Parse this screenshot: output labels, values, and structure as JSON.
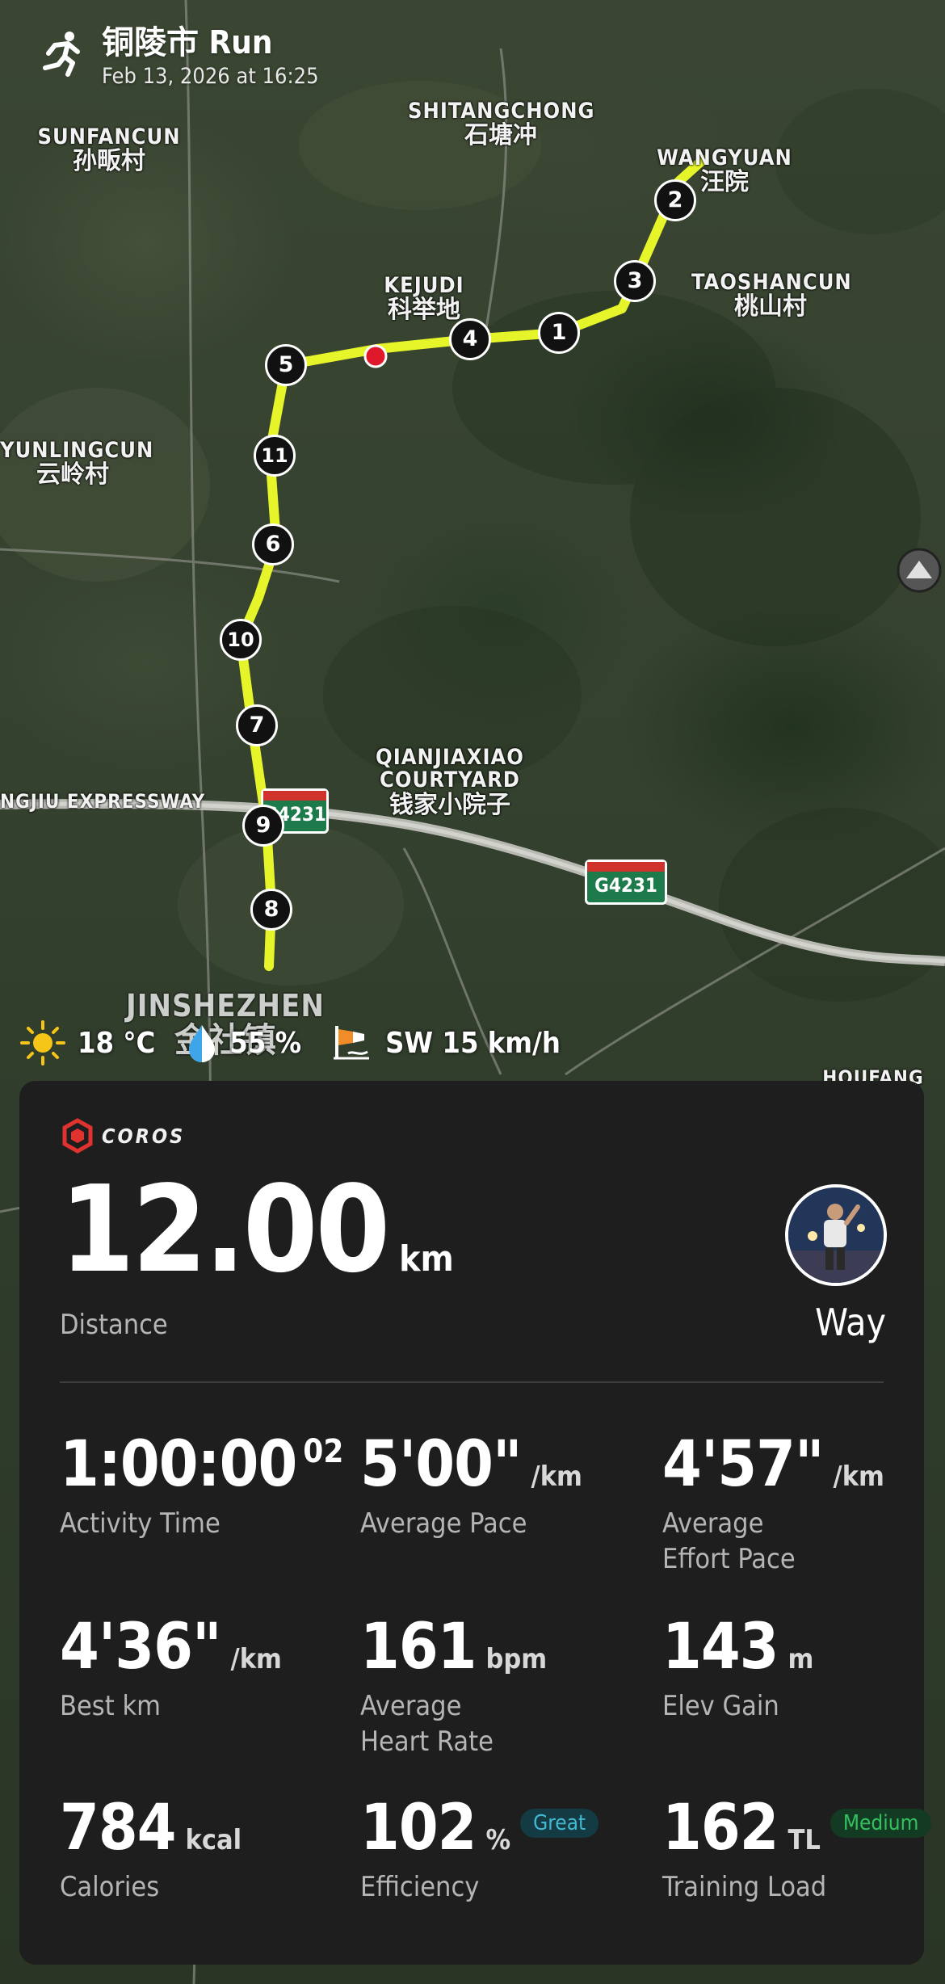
{
  "header": {
    "title": "铜陵市 Run",
    "datetime": "Feb 13, 2026 at 16:25"
  },
  "map": {
    "places": [
      {
        "en": "SHITANGCHONG",
        "zh": "石塘冲"
      },
      {
        "en": "SUNFANCUN",
        "zh": "孙畈村"
      },
      {
        "en": "WANGYUAN",
        "zh": "汪院"
      },
      {
        "en": "KEJUDI",
        "zh": "科举地"
      },
      {
        "en": "TAOSHANCUN",
        "zh": "桃山村"
      },
      {
        "en": "YUNLINGCUN",
        "zh": "云岭村"
      },
      {
        "en": "QIANJIAXIAO COURTYARD",
        "zh": "钱家小院子"
      },
      {
        "en": "JINSHEZHEN",
        "zh": "金社镇"
      },
      {
        "en": "HOUFANG",
        "zh": ""
      }
    ],
    "road_name": "NGJIU EXPRESSWAY",
    "highway_badge_1": "G4231",
    "highway_badge_2": "G4231",
    "route_color": "#e6f52a",
    "markers": [
      "1",
      "2",
      "3",
      "4",
      "5",
      "6",
      "7",
      "8",
      "9",
      "10",
      "11"
    ]
  },
  "weather": {
    "temperature": "18 °C",
    "humidity": "55 %",
    "wind": "SW 15 km/h"
  },
  "card": {
    "brand": "COROS",
    "distance_value": "12.00",
    "distance_unit": "km",
    "distance_label": "Distance",
    "user_name": "Way",
    "stats": {
      "activity_time": {
        "value": "1:00:00",
        "sup": "02",
        "label": "Activity Time"
      },
      "avg_pace": {
        "value": "5'00\"",
        "unit": "/km",
        "label": "Average Pace"
      },
      "avg_effort_pace": {
        "value": "4'57\"",
        "unit": "/km",
        "label_1": "Average",
        "label_2": "Effort Pace"
      },
      "best_km": {
        "value": "4'36\"",
        "unit": "/km",
        "label": "Best km"
      },
      "avg_hr": {
        "value": "161",
        "unit": "bpm",
        "label_1": "Average",
        "label_2": "Heart Rate"
      },
      "elev_gain": {
        "value": "143",
        "unit": "m",
        "label": "Elev Gain"
      },
      "calories": {
        "value": "784",
        "unit": "kcal",
        "label": "Calories"
      },
      "efficiency": {
        "value": "102",
        "unit": "%",
        "badge": "Great",
        "label": "Efficiency"
      },
      "training_load": {
        "value": "162",
        "unit": "TL",
        "badge": "Medium",
        "label": "Training Load"
      }
    }
  },
  "colors": {
    "accent_route": "#e6f52a",
    "start_dot": "#e0182c",
    "badge_great": "#43b8d2",
    "badge_medium": "#35c060"
  }
}
